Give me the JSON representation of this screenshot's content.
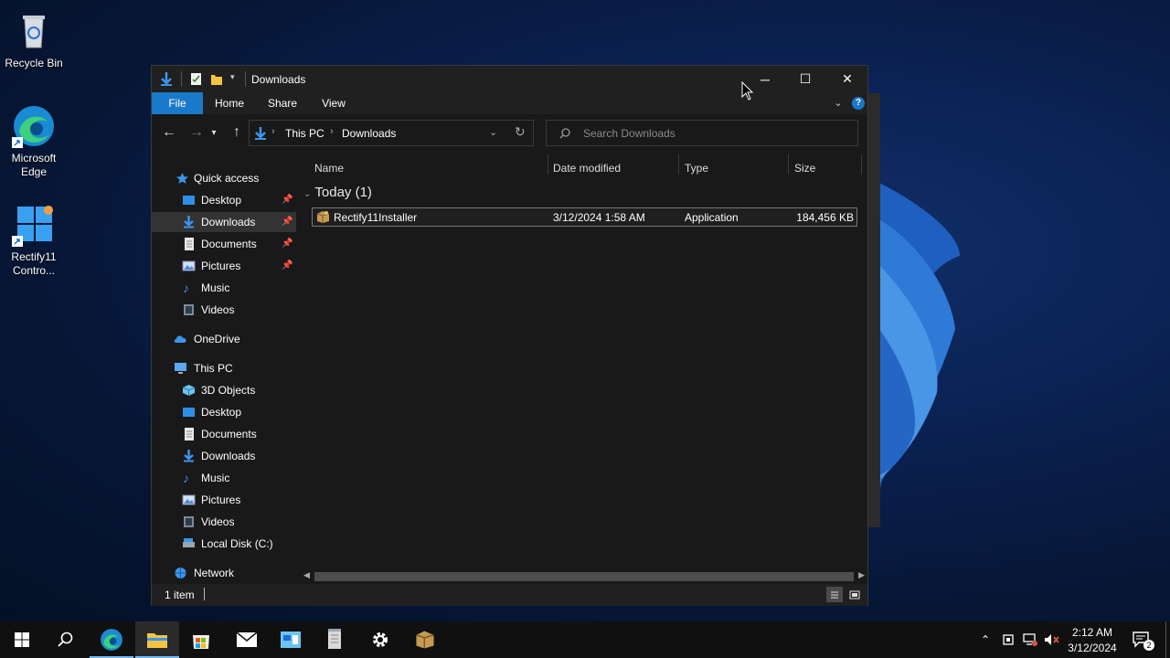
{
  "desktop": {
    "icons": [
      {
        "label": "Recycle Bin",
        "icon": "recycle-bin-icon"
      },
      {
        "label": "Microsoft Edge",
        "icon": "edge-icon"
      },
      {
        "label": "Rectify11 Contro...",
        "icon": "rectify11-control-panel-icon"
      }
    ]
  },
  "window": {
    "title": "Downloads",
    "controls": {
      "minimize": "─",
      "maximize": "☐",
      "close": "✕"
    }
  },
  "ribbon": {
    "tabs": [
      "File",
      "Home",
      "Share",
      "View"
    ],
    "help": "?"
  },
  "address": {
    "crumbs": [
      "This PC",
      "Downloads"
    ],
    "search_placeholder": "Search Downloads"
  },
  "navpane": {
    "quick_access": "Quick access",
    "quick_items": [
      "Desktop",
      "Downloads",
      "Documents",
      "Pictures",
      "Music",
      "Videos"
    ],
    "onedrive": "OneDrive",
    "this_pc": "This PC",
    "pc_items": [
      "3D Objects",
      "Desktop",
      "Documents",
      "Downloads",
      "Music",
      "Pictures",
      "Videos",
      "Local Disk (C:)"
    ],
    "network": "Network"
  },
  "content": {
    "columns": [
      "Name",
      "Date modified",
      "Type",
      "Size"
    ],
    "group": "Today (1)",
    "files": [
      {
        "name": "Rectify11Installer",
        "date": "3/12/2024 1:58 AM",
        "type": "Application",
        "size": "184,456 KB"
      }
    ]
  },
  "status": {
    "items": "1 item"
  },
  "taskbar": {
    "time": "2:12 AM",
    "date": "3/12/2024",
    "notifications": "2"
  },
  "colors": {
    "accent": "#1979ca",
    "window_bg": "#191919",
    "titlebar": "#202020"
  }
}
